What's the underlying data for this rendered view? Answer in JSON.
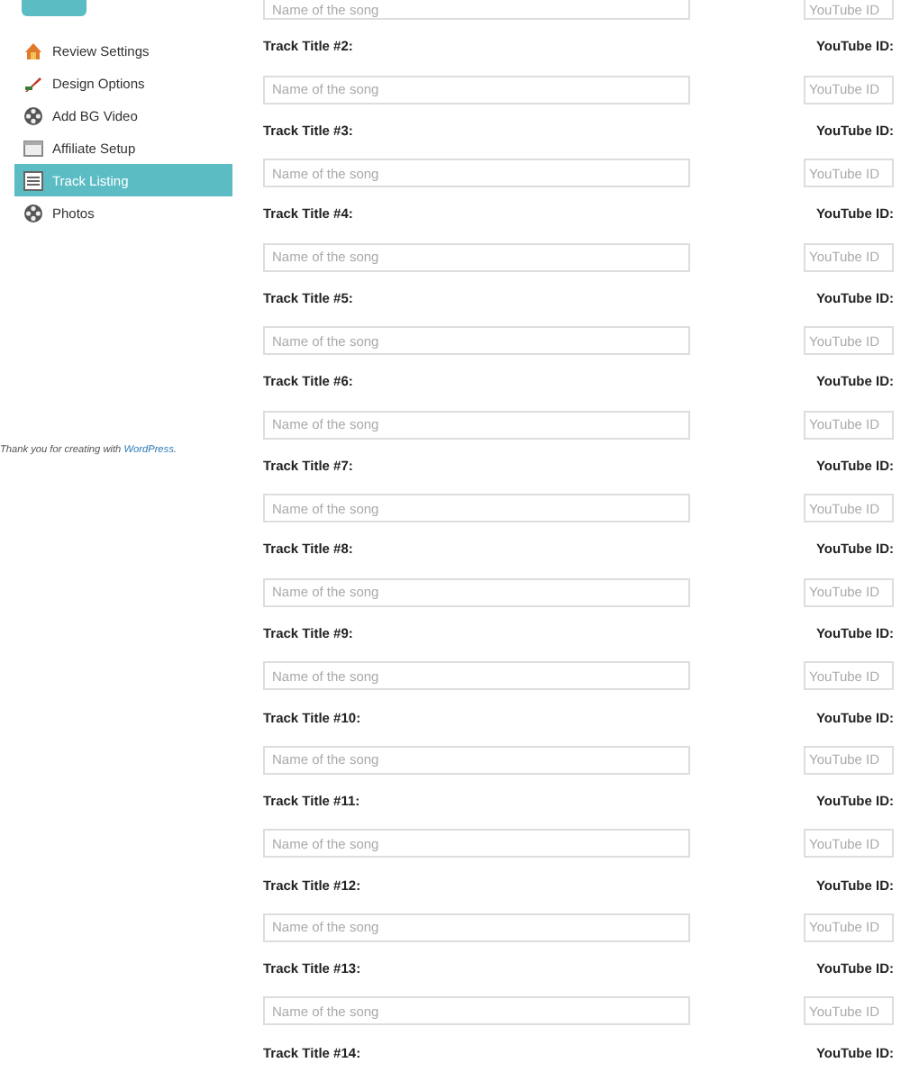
{
  "sidebar": {
    "items": [
      {
        "label": "Review Settings",
        "selected": false
      },
      {
        "label": "Design Options",
        "selected": false
      },
      {
        "label": "Add BG Video",
        "selected": false
      },
      {
        "label": "Affiliate Setup",
        "selected": false
      },
      {
        "label": "Track Listing",
        "selected": true
      },
      {
        "label": "Photos",
        "selected": false
      }
    ]
  },
  "footer": {
    "text": "Thank you for creating with ",
    "link": "WordPress",
    "after": "."
  },
  "tracks": [
    {
      "title_placeholder": "Name of the song",
      "id_placeholder": "YouTube ID"
    },
    {
      "title_label": "Track Title #2:",
      "id_label": "YouTube ID:",
      "title_placeholder": "Name of the song",
      "id_placeholder": "YouTube ID"
    },
    {
      "title_label": "Track Title #3:",
      "id_label": "YouTube ID:",
      "title_placeholder": "Name of the song",
      "id_placeholder": "YouTube ID"
    },
    {
      "title_label": "Track Title #4:",
      "id_label": "YouTube ID:",
      "title_placeholder": "Name of the song",
      "id_placeholder": "YouTube ID"
    },
    {
      "title_label": "Track Title #5:",
      "id_label": "YouTube ID:",
      "title_placeholder": "Name of the song",
      "id_placeholder": "YouTube ID"
    },
    {
      "title_label": "Track Title #6:",
      "id_label": "YouTube ID:",
      "title_placeholder": "Name of the song",
      "id_placeholder": "YouTube ID"
    },
    {
      "title_label": "Track Title #7:",
      "id_label": "YouTube ID:",
      "title_placeholder": "Name of the song",
      "id_placeholder": "YouTube ID"
    },
    {
      "title_label": "Track Title #8:",
      "id_label": "YouTube ID:",
      "title_placeholder": "Name of the song",
      "id_placeholder": "YouTube ID"
    },
    {
      "title_label": "Track Title #9:",
      "id_label": "YouTube ID:",
      "title_placeholder": "Name of the song",
      "id_placeholder": "YouTube ID"
    },
    {
      "title_label": "Track Title #10:",
      "id_label": "YouTube ID:",
      "title_placeholder": "Name of the song",
      "id_placeholder": "YouTube ID"
    },
    {
      "title_label": "Track Title #11:",
      "id_label": "YouTube ID:",
      "title_placeholder": "Name of the song",
      "id_placeholder": "YouTube ID"
    },
    {
      "title_label": "Track Title #12:",
      "id_label": "YouTube ID:",
      "title_placeholder": "Name of the song",
      "id_placeholder": "YouTube ID"
    },
    {
      "title_label": "Track Title #13:",
      "id_label": "YouTube ID:",
      "title_placeholder": "Name of the song",
      "id_placeholder": "YouTube ID"
    },
    {
      "title_label": "Track Title #14:",
      "id_label": "YouTube ID:"
    }
  ]
}
